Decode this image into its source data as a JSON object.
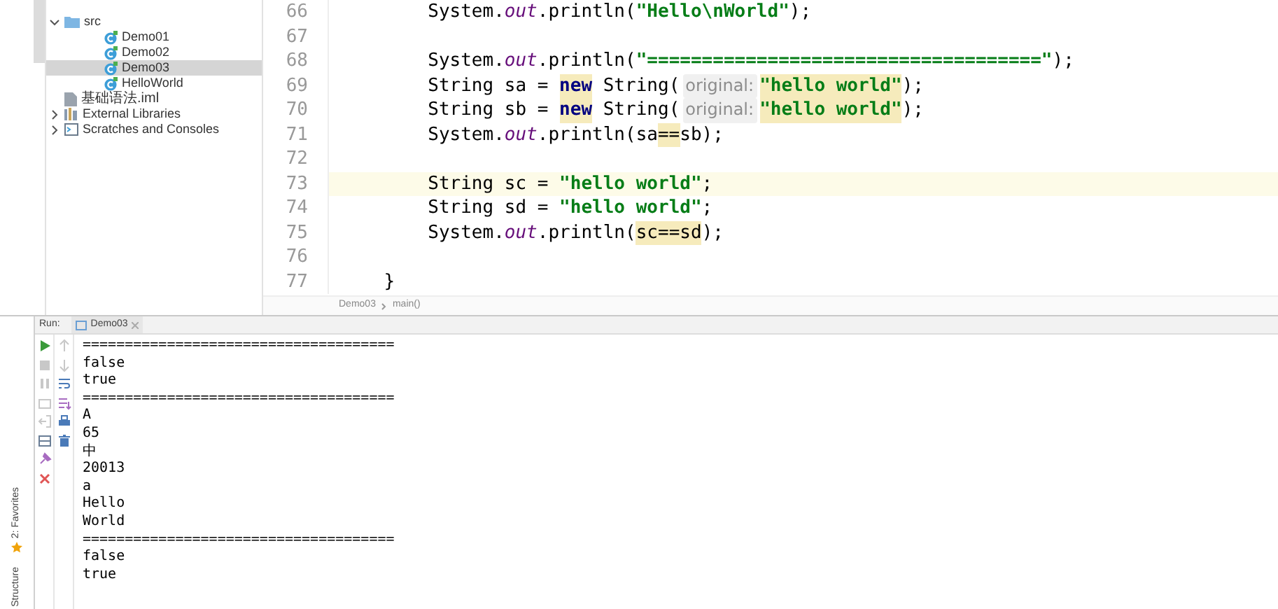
{
  "sidebar": {
    "tabs": [
      {
        "label": "2: Favorites"
      },
      {
        "label": "Structure"
      }
    ]
  },
  "project_tree": {
    "items": [
      {
        "label": "src",
        "kind": "folder",
        "expanded": true,
        "selected": false,
        "children": [
          {
            "label": "Demo01",
            "kind": "class",
            "selected": false
          },
          {
            "label": "Demo02",
            "kind": "class",
            "selected": false
          },
          {
            "label": "Demo03",
            "kind": "class",
            "selected": true
          },
          {
            "label": "HelloWorld",
            "kind": "class",
            "selected": false
          }
        ]
      },
      {
        "label": "基础语法.iml",
        "kind": "module",
        "selected": false
      },
      {
        "label": "External Libraries",
        "kind": "library",
        "expanded": false,
        "selected": false
      },
      {
        "label": "Scratches and Consoles",
        "kind": "scratch",
        "expanded": false,
        "selected": false
      }
    ]
  },
  "editor": {
    "lines": [
      {
        "number": "66",
        "current": false,
        "tokens": [
          {
            "text": "        System.",
            "kind": "plain"
          },
          {
            "text": "out",
            "kind": "field"
          },
          {
            "text": ".println(",
            "kind": "plain"
          },
          {
            "text": "\"Hello\\nWorld\"",
            "kind": "string"
          },
          {
            "text": ");",
            "kind": "plain"
          }
        ]
      },
      {
        "number": "67",
        "current": false
      },
      {
        "number": "68",
        "current": false,
        "tokens": [
          {
            "text": "        System.",
            "kind": "plain"
          },
          {
            "text": "out",
            "kind": "field"
          },
          {
            "text": ".println(",
            "kind": "plain"
          },
          {
            "text": "\"====================================\"",
            "kind": "string"
          },
          {
            "text": ");",
            "kind": "plain"
          }
        ]
      },
      {
        "number": "69",
        "current": false,
        "tokens": [
          {
            "text": "        String sa = ",
            "kind": "plain"
          },
          {
            "text": "new",
            "kind": "keyword",
            "marked": true
          },
          {
            "text": " String(",
            "kind": "plain"
          },
          {
            "text": "original:",
            "kind": "hint"
          },
          {
            "text": "\"hello world\"",
            "kind": "string",
            "marked": true
          },
          {
            "text": ");",
            "kind": "plain"
          }
        ]
      },
      {
        "number": "70",
        "current": false,
        "tokens": [
          {
            "text": "        String sb = ",
            "kind": "plain"
          },
          {
            "text": "new",
            "kind": "keyword",
            "marked": true
          },
          {
            "text": " String(",
            "kind": "plain"
          },
          {
            "text": "original:",
            "kind": "hint"
          },
          {
            "text": "\"hello world\"",
            "kind": "string",
            "marked": true
          },
          {
            "text": ");",
            "kind": "plain"
          }
        ]
      },
      {
        "number": "71",
        "current": false,
        "tokens": [
          {
            "text": "        System.",
            "kind": "plain"
          },
          {
            "text": "out",
            "kind": "field"
          },
          {
            "text": ".println(sa",
            "kind": "plain"
          },
          {
            "text": "==",
            "kind": "plain",
            "marked": true
          },
          {
            "text": "sb);",
            "kind": "plain"
          }
        ]
      },
      {
        "number": "72",
        "current": false
      },
      {
        "number": "73",
        "current": true,
        "tokens": [
          {
            "text": "        String sc = ",
            "kind": "plain"
          },
          {
            "text": "\"hello world\"",
            "kind": "string"
          },
          {
            "text": ";",
            "kind": "plain"
          }
        ]
      },
      {
        "number": "74",
        "current": false,
        "tokens": [
          {
            "text": "        String sd = ",
            "kind": "plain"
          },
          {
            "text": "\"hello world\"",
            "kind": "string"
          },
          {
            "text": ";",
            "kind": "plain"
          }
        ]
      },
      {
        "number": "75",
        "current": false,
        "tokens": [
          {
            "text": "        System.",
            "kind": "plain"
          },
          {
            "text": "out",
            "kind": "field"
          },
          {
            "text": ".println(",
            "kind": "plain"
          },
          {
            "text": "sc==sd",
            "kind": "plain",
            "marked": true
          },
          {
            "text": ");",
            "kind": "plain"
          }
        ]
      },
      {
        "number": "76",
        "current": false
      },
      {
        "number": "77",
        "current": false,
        "tokens": [
          {
            "text": "    }",
            "kind": "plain"
          }
        ]
      }
    ],
    "breadcrumb": [
      "Demo03",
      "main()"
    ]
  },
  "run_panel": {
    "label": "Run:",
    "tab": "Demo03",
    "output": [
      "=====================================",
      "false",
      "true",
      "=====================================",
      "A",
      "65",
      "中",
      "20013",
      "a",
      "Hello",
      "World",
      "=====================================",
      "false",
      "true"
    ]
  }
}
